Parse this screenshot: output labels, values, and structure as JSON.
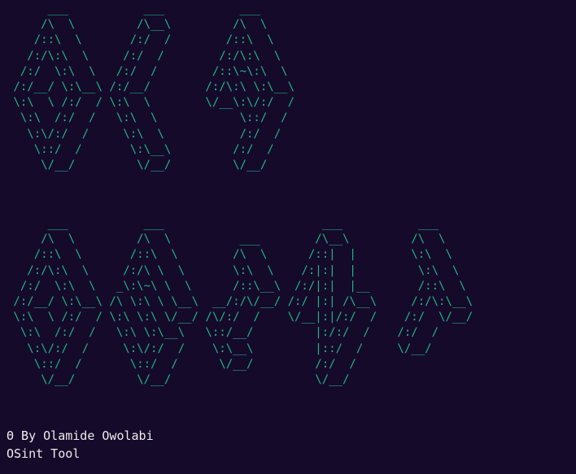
{
  "terminal": {
    "background": "#160a2a",
    "banner_color": "#1fb58a",
    "text_color": "#ececec",
    "banner_top": "      ___           ___           ___     \n     /\\  \\         /\\__\\         /\\  \\    \n    /::\\  \\       /:/  /        /::\\  \\   \n   /:/\\:\\  \\     /:/  /        /:/\\:\\  \\  \n  /:/  \\:\\  \\   /:/  /        /::\\~\\:\\  \\ \n /:/__/ \\:\\__\\ /:/__/        /:/\\:\\ \\:\\__\\\n \\:\\  \\ /:/  / \\:\\  \\        \\/__\\:\\/:/  /\n  \\:\\  /:/  /   \\:\\  \\            \\::/  / \n   \\:\\/:/  /     \\:\\  \\           /:/  /  \n    \\::/  /       \\:\\__\\         /:/  /   \n     \\/__/         \\/__/         \\/__/    ",
    "banner_bottom": "      ___           ___                       ___           ___     \n     /\\  \\         /\\  \\          ___        /\\__\\         /\\  \\    \n    /::\\  \\       /::\\  \\        /\\  \\      /::|  |        \\:\\  \\   \n   /:/\\:\\  \\     /:/\\ \\  \\       \\:\\  \\    /:|:|  |         \\:\\  \\  \n  /:/  \\:\\  \\   _\\:\\~\\ \\  \\      /::\\__\\  /:/|:|  |__       /::\\  \\ \n /:/__/ \\:\\__\\ /\\ \\:\\ \\ \\__\\  __/:/\\/__/ /:/ |:| /\\__\\     /:/\\:\\__\\\n \\:\\  \\ /:/  / \\:\\ \\:\\ \\/__/ /\\/:/  /    \\/__|:|/:/  /    /:/  \\/__/\n  \\:\\  /:/  /   \\:\\ \\:\\__\\   \\::/__/         |:/:/  /    /:/  /     \n   \\:\\/:/  /     \\:\\/:/  /    \\:\\__\\         |::/  /     \\/__/      \n    \\::/  /       \\::/  /      \\/__/         /:/  /                 \n     \\/__/         \\/__/                     \\/__/                  ",
    "credit_line": "Θ By Olamide Owolabi",
    "tagline": "OSint Tool"
  }
}
